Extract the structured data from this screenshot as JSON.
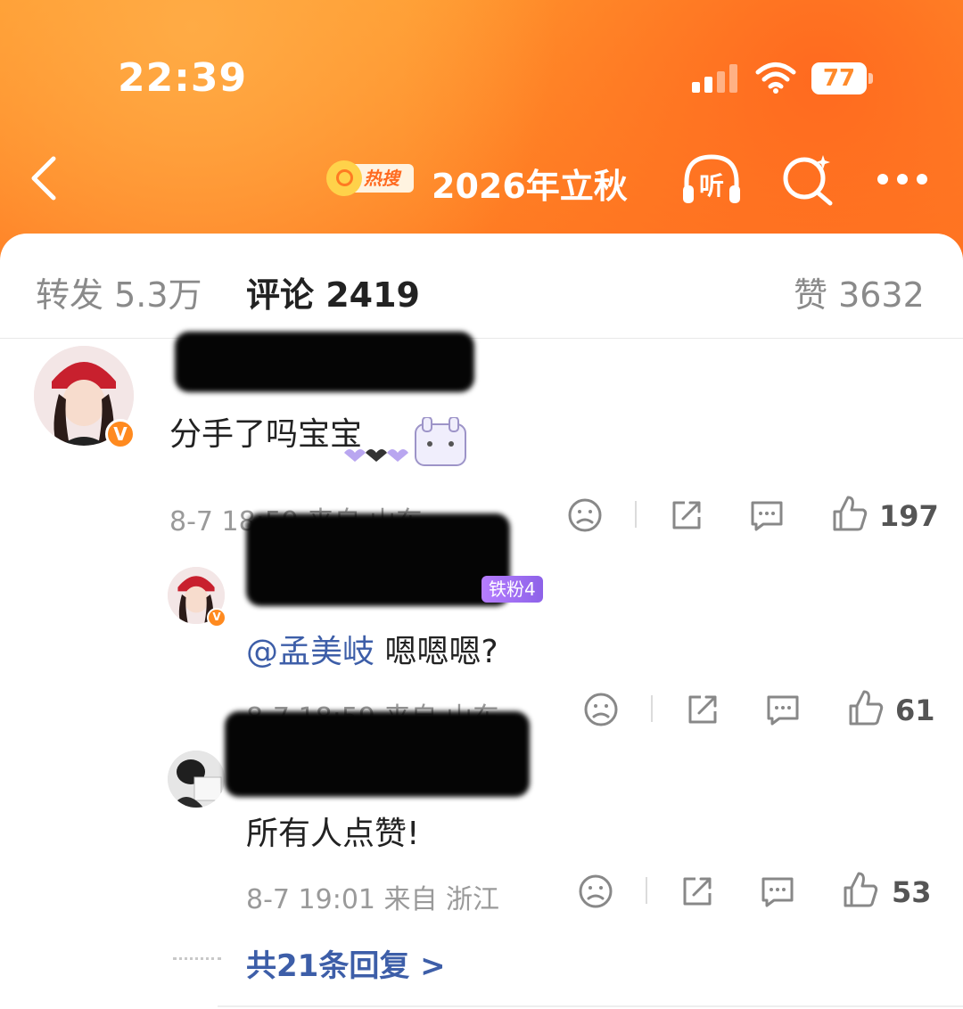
{
  "status_bar": {
    "time": "22:39",
    "battery": "77"
  },
  "header": {
    "hot_label": "热搜",
    "title": "2026年立秋",
    "listen_label": "听"
  },
  "tabs": {
    "repost": "转发 5.3万",
    "comments": "评论 2419",
    "likes": "赞 3632"
  },
  "comments": [
    {
      "text": "分手了吗宝宝",
      "meta_visible": "8-7 18:59 来自 山东",
      "likes": "197",
      "avatar_badge": "V"
    },
    {
      "mention": "@孟美岐",
      "text": "嗯嗯嗯?",
      "meta_visible": "8-7 18:59 来自 山东",
      "fan_badge": "铁粉4",
      "likes": "61",
      "avatar_badge": "V"
    },
    {
      "text": "所有人点赞!",
      "meta_visible": "8-7 19:01 来自 浙江",
      "likes": "53"
    }
  ],
  "more_replies": "共21条回复 >",
  "colors": {
    "header_orange": "#ff7a22",
    "link_blue": "#3d5ea8",
    "fan_badge": "#a06ff2"
  }
}
